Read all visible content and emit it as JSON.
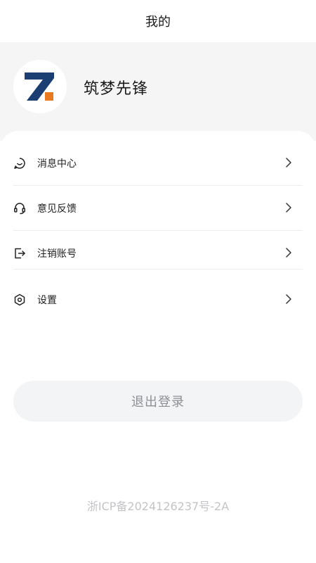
{
  "header": {
    "title": "我的"
  },
  "profile": {
    "username": "筑梦先锋",
    "avatar_icon": "zhumeng-logo-icon",
    "logo_colors": {
      "navy": "#1c3f73",
      "orange": "#ea7a1f"
    }
  },
  "menu": {
    "items": [
      {
        "label": "消息中心",
        "icon": "chat-bubble-icon"
      },
      {
        "label": "意见反馈",
        "icon": "headset-icon"
      },
      {
        "label": "注销账号",
        "icon": "logout-box-icon"
      },
      {
        "label": "设置",
        "icon": "hexagon-settings-icon"
      }
    ]
  },
  "logout": {
    "label": "退出登录"
  },
  "footer": {
    "icp": "浙ICP备2024126237号-2A"
  },
  "colors": {
    "profile_bg": "#f5f5f6",
    "divider": "#ededed",
    "button_bg": "#f3f4f6",
    "button_text": "#8f8f94",
    "footer_text": "#c4c4c8"
  }
}
